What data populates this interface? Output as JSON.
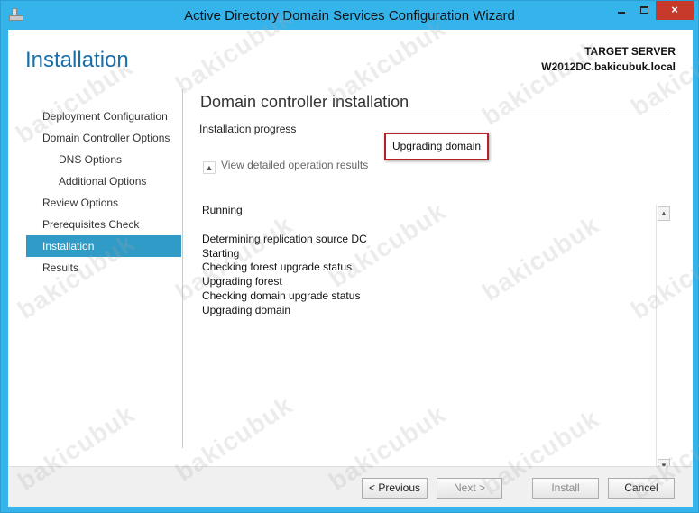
{
  "window": {
    "title": "Active Directory Domain Services Configuration Wizard",
    "controls": {
      "close_glyph": "×"
    }
  },
  "header": {
    "page_title": "Installation",
    "target_label": "TARGET SERVER",
    "target_name": "W2012DC.bakicubuk.local"
  },
  "nav": {
    "items": [
      {
        "label": "Deployment Configuration",
        "level": 0,
        "active": false
      },
      {
        "label": "Domain Controller Options",
        "level": 0,
        "active": false
      },
      {
        "label": "DNS Options",
        "level": 1,
        "active": false
      },
      {
        "label": "Additional Options",
        "level": 1,
        "active": false
      },
      {
        "label": "Review Options",
        "level": 0,
        "active": false
      },
      {
        "label": "Prerequisites Check",
        "level": 0,
        "active": false
      },
      {
        "label": "Installation",
        "level": 0,
        "active": true
      },
      {
        "label": "Results",
        "level": 0,
        "active": false
      }
    ]
  },
  "main": {
    "title": "Domain controller installation",
    "progress_label": "Installation progress",
    "status": "Upgrading domain",
    "details_toggle": "View detailed operation results",
    "log_status": "Running",
    "log_lines": [
      "Determining replication source DC",
      "Starting",
      "Checking forest upgrade status",
      "Upgrading forest",
      "Checking domain upgrade status",
      "Upgrading domain"
    ]
  },
  "footer": {
    "previous": "< Previous",
    "next": "Next >",
    "install": "Install",
    "cancel": "Cancel"
  },
  "watermark": "bakicubuk",
  "colors": {
    "titlebar": "#35b4ec",
    "accent_title": "#1a6fa8",
    "nav_active": "#2f9bc6",
    "close_button": "#c7392b",
    "highlight_border": "#b4202a"
  }
}
